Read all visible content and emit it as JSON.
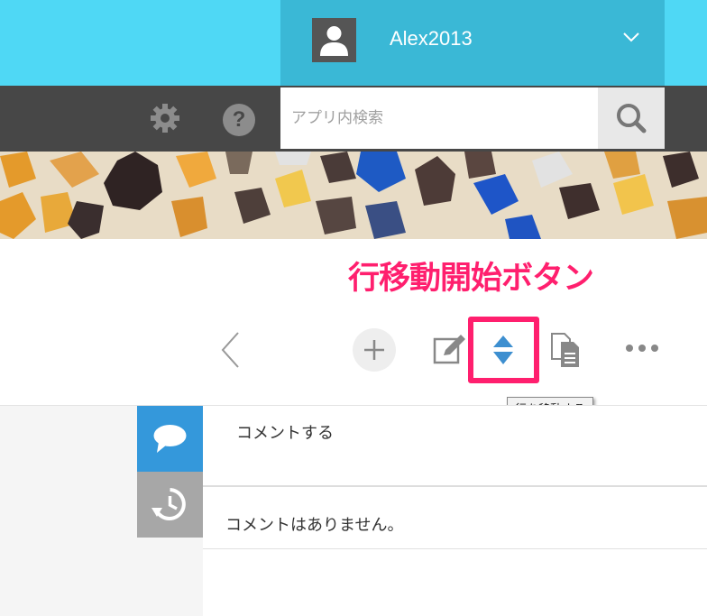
{
  "header": {
    "username": "Alex2013"
  },
  "toolbar": {
    "search_placeholder": "アプリ内検索"
  },
  "annotation": {
    "label": "行移動開始ボタン"
  },
  "record_toolbar": {
    "move_tooltip": "行を移動する"
  },
  "comments": {
    "input_placeholder": "コメントする",
    "empty_message": "コメントはありません。"
  },
  "colors": {
    "header_bg": "#4fd8f5",
    "user_area_bg": "#3ab8d6",
    "toolbar_bg": "#474747",
    "annotation": "#ff1f6e",
    "comment_tab": "#3498db",
    "move_icon": "#3d8fd0"
  }
}
